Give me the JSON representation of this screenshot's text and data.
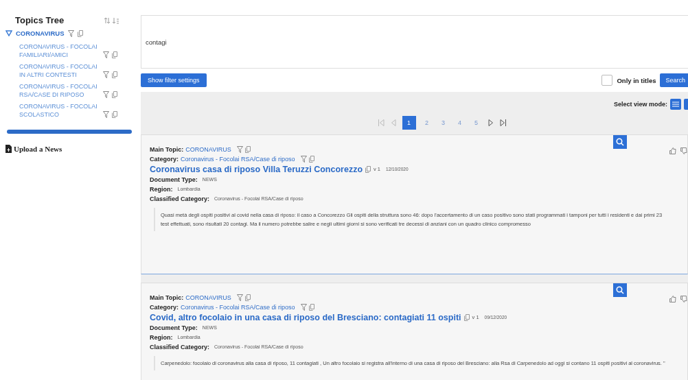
{
  "sidebar": {
    "title": "Topics Tree",
    "root": {
      "label": "CORONAVIRUS",
      "expanded": true,
      "children": [
        {
          "label": "CORONAVIRUS - FOCOLAI FAMILIARI/AMICI"
        },
        {
          "label": "CORONAVIRUS - FOCOLAI IN ALTRI CONTESTI"
        },
        {
          "label": "CORONAVIRUS - FOCOLAI RSA/CASE DI RIPOSO"
        },
        {
          "label": "CORONAVIRUS - FOCOLAI SCOLASTICO"
        }
      ]
    },
    "upload": "Upload a News"
  },
  "search": {
    "value": "contagi",
    "filter_button": "Show filter settings",
    "only_in_titles": {
      "label": "Only in titles",
      "checked": false
    },
    "search_button": "Search"
  },
  "view_mode": {
    "label": "Select view mode:"
  },
  "pagination": {
    "pages": [
      {
        "label": "1",
        "selected": true
      },
      {
        "label": "2",
        "selected": false
      },
      {
        "label": "3",
        "selected": false
      },
      {
        "label": "4",
        "selected": false
      },
      {
        "label": "5",
        "selected": false
      }
    ]
  },
  "results": [
    {
      "main_topic_label": "Main Topic:",
      "main_topic": "CORONAVIRUS",
      "category_label": "Category:",
      "category": "Coronavirus - Focolai RSA/Case di riposo",
      "title": "Coronavirus casa di riposo Villa Teruzzi Concorezzo",
      "version": "v 1",
      "date": "12/10/2020",
      "doc_type_label": "Document Type:",
      "doc_type": "NEWS",
      "region_label": "Region:",
      "region": "Lombardia",
      "classified_label": "Classified Category:",
      "classified": "Coronavirus - Focolai RSA/Case di riposo",
      "snippet": "Quasi metà degli ospiti positivi al covid nella casa di riposo: il caso a Concorezzo Gli ospiti della struttura sono 46: dopo l'accertamento di un caso positivo sono stati programmati i tamponi per tutti i residenti e dai primi 23 test effettuati, sono risultati 20 contagi. Ma il numero potrebbe salire e negli ultimi giorni si sono verificati tre decessi di anziani con un quadro clinico compromesso"
    },
    {
      "main_topic_label": "Main Topic:",
      "main_topic": "CORONAVIRUS",
      "category_label": "Category:",
      "category": "Coronavirus - Focolai RSA/Case di riposo",
      "title": "Covid, altro focolaio in una casa di riposo del Bresciano: contagiati 11 ospiti",
      "version": "v 1",
      "date": "09/12/2020",
      "doc_type_label": "Document Type:",
      "doc_type": "NEWS",
      "region_label": "Region:",
      "region": "Lombardia",
      "classified_label": "Classified Category:",
      "classified": "Coronavirus - Focolai RSA/Case di riposo",
      "snippet": "Carpenedolo: focolaio di coronavirus alla casa di riposo, 11 contagiati , Un altro focolaio si registra all'interno di una casa di riposo del Bresciano: alla Rsa di Carpenedolo ad oggi si contano 11 ospiti positivi al coronavirus. \""
    }
  ]
}
